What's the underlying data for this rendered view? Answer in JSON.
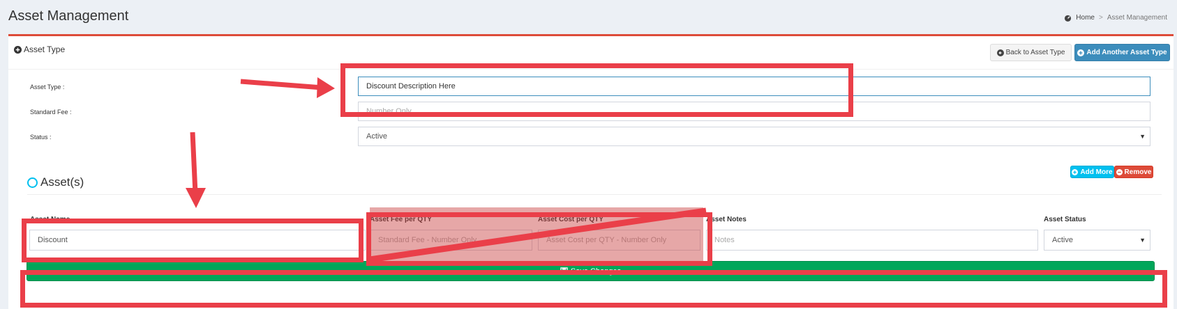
{
  "page": {
    "title": "Asset Management",
    "breadcrumb": {
      "home": "Home",
      "separator": ">",
      "current": "Asset Management"
    }
  },
  "box": {
    "title": "Asset Type",
    "back_button": "Back to Asset Type",
    "add_button": "Add Another Asset Type"
  },
  "form": {
    "asset_type_label": "Asset Type :",
    "asset_type_value": "Discount Description Here",
    "standard_fee_label": "Standard Fee :",
    "standard_fee_placeholder": "Number Only",
    "status_label": "Status :",
    "status_value": "Active"
  },
  "assets": {
    "title": "Asset(s)",
    "add_more": "Add More",
    "remove": "Remove",
    "columns": {
      "name": "Asset Name",
      "fee": "Asset Fee per QTY",
      "cost": "Asset Cost per QTY",
      "notes": "Asset Notes",
      "status": "Asset Status"
    },
    "row": {
      "name_value": "Discount",
      "fee_placeholder": "Standard Fee - Number Only",
      "cost_placeholder": "Asset Cost per QTY - Number Only",
      "notes_placeholder": "Notes",
      "status_value": "Active"
    }
  },
  "save_button": "Save Changes",
  "colors": {
    "annotation": "#ea3f49",
    "save": "#00a65a",
    "primary": "#3c8dbc",
    "info": "#00c0ef",
    "danger": "#dd4b39"
  },
  "icons": [
    "home-icon",
    "plus-circle-icon",
    "arrow-left-circle-icon",
    "circle-icon",
    "minus-circle-icon",
    "save-icon",
    "chevron-down-icon"
  ]
}
